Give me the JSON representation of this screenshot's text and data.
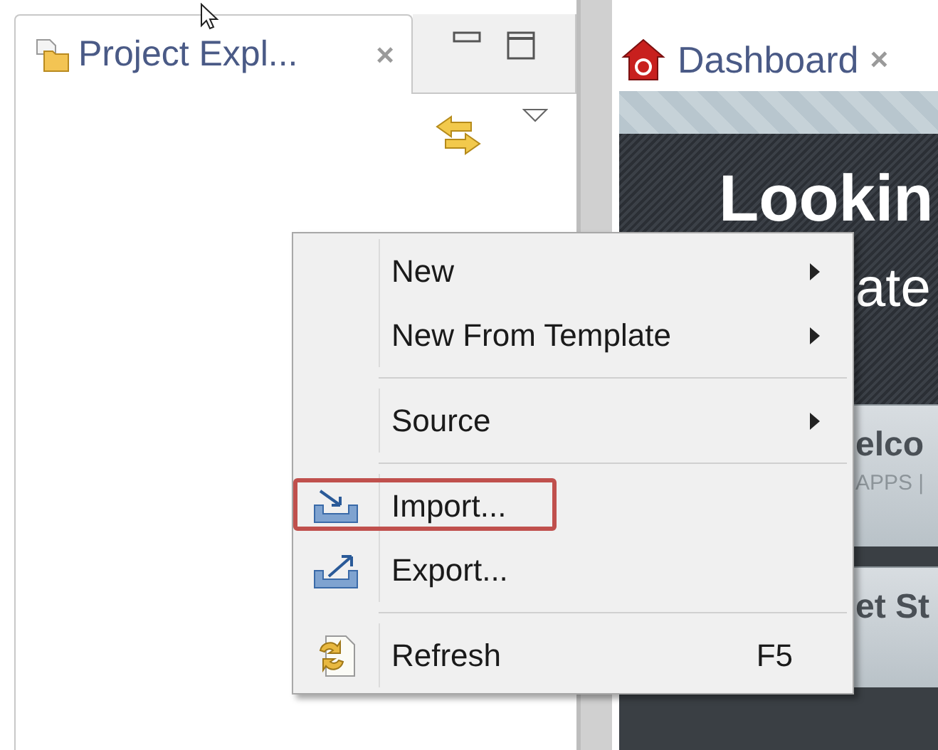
{
  "left_view": {
    "tab": {
      "label": "Project Expl...",
      "close": "×",
      "selected": true
    }
  },
  "editor": {
    "tab": {
      "label": "Dashboard",
      "close": "×",
      "selected": true
    },
    "banner": {
      "line_1": "Lookin",
      "line_2": "ate"
    },
    "cards": [
      {
        "title": "elco",
        "subtitle": "APPS |"
      },
      {
        "title": "et St"
      }
    ]
  },
  "context_menu": {
    "items": [
      {
        "kind": "item",
        "label": "New",
        "submenu": true,
        "highlighted": false
      },
      {
        "kind": "item",
        "label": "New From Template",
        "submenu": true,
        "highlighted": false
      },
      {
        "kind": "separator"
      },
      {
        "kind": "item",
        "label": "Source",
        "submenu": true,
        "highlighted": false
      },
      {
        "kind": "separator"
      },
      {
        "kind": "item",
        "label": "Import...",
        "submenu": false,
        "highlighted": true
      },
      {
        "kind": "item",
        "label": "Export...",
        "submenu": false,
        "highlighted": false
      },
      {
        "kind": "separator"
      },
      {
        "kind": "item",
        "label": "Refresh",
        "shortcut": "F5",
        "submenu": false,
        "highlighted": false
      }
    ]
  }
}
